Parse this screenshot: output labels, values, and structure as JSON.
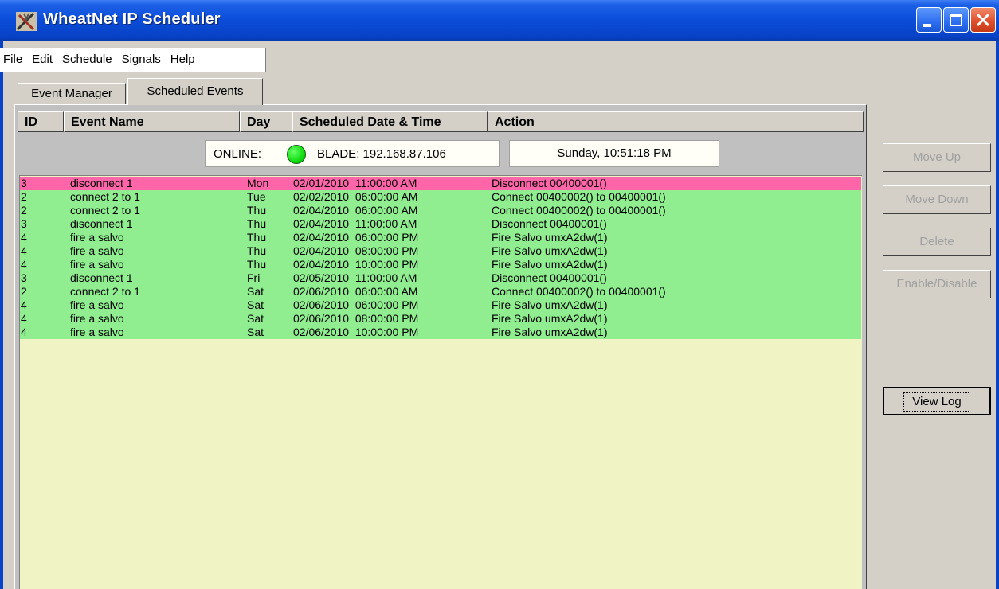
{
  "window": {
    "title": "WheatNet IP Scheduler",
    "app_icon": "wheatnet-app-icon",
    "controls": [
      "minimize-icon",
      "maximize-icon",
      "close-icon"
    ]
  },
  "menu": [
    "File",
    "Edit",
    "Schedule",
    "Signals",
    "Help"
  ],
  "tabs": [
    {
      "label": "Event Manager",
      "active": false
    },
    {
      "label": "Scheduled Events",
      "active": true
    }
  ],
  "columns": [
    "ID",
    "Event Name",
    "Day",
    "Scheduled Date & Time",
    "Action"
  ],
  "status": {
    "online_label": "ONLINE:",
    "online_color": "#11dd11",
    "blade": "BLADE: 192.168.87.106",
    "clock": "Sunday, 10:51:18 PM"
  },
  "colors": {
    "row_pending": "#ff66aa",
    "row_scheduled": "#90ee90",
    "list_background": "#f0f4c4"
  },
  "events": [
    {
      "id": "3",
      "name": "disconnect 1",
      "day": "Mon",
      "datetime": "02/01/2010  11:00:00 AM",
      "action": "Disconnect 00400001()",
      "status": "red"
    },
    {
      "id": "2",
      "name": "connect 2 to 1",
      "day": "Tue",
      "datetime": "02/02/2010  06:00:00 AM",
      "action": "Connect 00400002() to 00400001()",
      "status": "green"
    },
    {
      "id": "2",
      "name": "connect 2 to 1",
      "day": "Thu",
      "datetime": "02/04/2010  06:00:00 AM",
      "action": "Connect 00400002() to 00400001()",
      "status": "green"
    },
    {
      "id": "3",
      "name": "disconnect 1",
      "day": "Thu",
      "datetime": "02/04/2010  11:00:00 AM",
      "action": "Disconnect 00400001()",
      "status": "green"
    },
    {
      "id": "4",
      "name": "fire a salvo",
      "day": "Thu",
      "datetime": "02/04/2010  06:00:00 PM",
      "action": "Fire Salvo umxA2dw(1)",
      "status": "green"
    },
    {
      "id": "4",
      "name": "fire a salvo",
      "day": "Thu",
      "datetime": "02/04/2010  08:00:00 PM",
      "action": "Fire Salvo umxA2dw(1)",
      "status": "green"
    },
    {
      "id": "4",
      "name": "fire a salvo",
      "day": "Thu",
      "datetime": "02/04/2010  10:00:00 PM",
      "action": "Fire Salvo umxA2dw(1)",
      "status": "green"
    },
    {
      "id": "3",
      "name": "disconnect 1",
      "day": "Fri",
      "datetime": "02/05/2010  11:00:00 AM",
      "action": "Disconnect 00400001()",
      "status": "green"
    },
    {
      "id": "2",
      "name": "connect 2 to 1",
      "day": "Sat",
      "datetime": "02/06/2010  06:00:00 AM",
      "action": "Connect 00400002() to 00400001()",
      "status": "green"
    },
    {
      "id": "4",
      "name": "fire a salvo",
      "day": "Sat",
      "datetime": "02/06/2010  06:00:00 PM",
      "action": "Fire Salvo umxA2dw(1)",
      "status": "green"
    },
    {
      "id": "4",
      "name": "fire a salvo",
      "day": "Sat",
      "datetime": "02/06/2010  08:00:00 PM",
      "action": "Fire Salvo umxA2dw(1)",
      "status": "green"
    },
    {
      "id": "4",
      "name": "fire a salvo",
      "day": "Sat",
      "datetime": "02/06/2010  10:00:00 PM",
      "action": "Fire Salvo umxA2dw(1)",
      "status": "green"
    }
  ],
  "buttons": {
    "move_up": {
      "label": "Move Up",
      "enabled": false
    },
    "move_down": {
      "label": "Move Down",
      "enabled": false
    },
    "delete": {
      "label": "Delete",
      "enabled": false
    },
    "enable_disable": {
      "label": "Enable/Disable",
      "enabled": false
    },
    "view_log": {
      "label": "View Log",
      "enabled": true
    }
  }
}
